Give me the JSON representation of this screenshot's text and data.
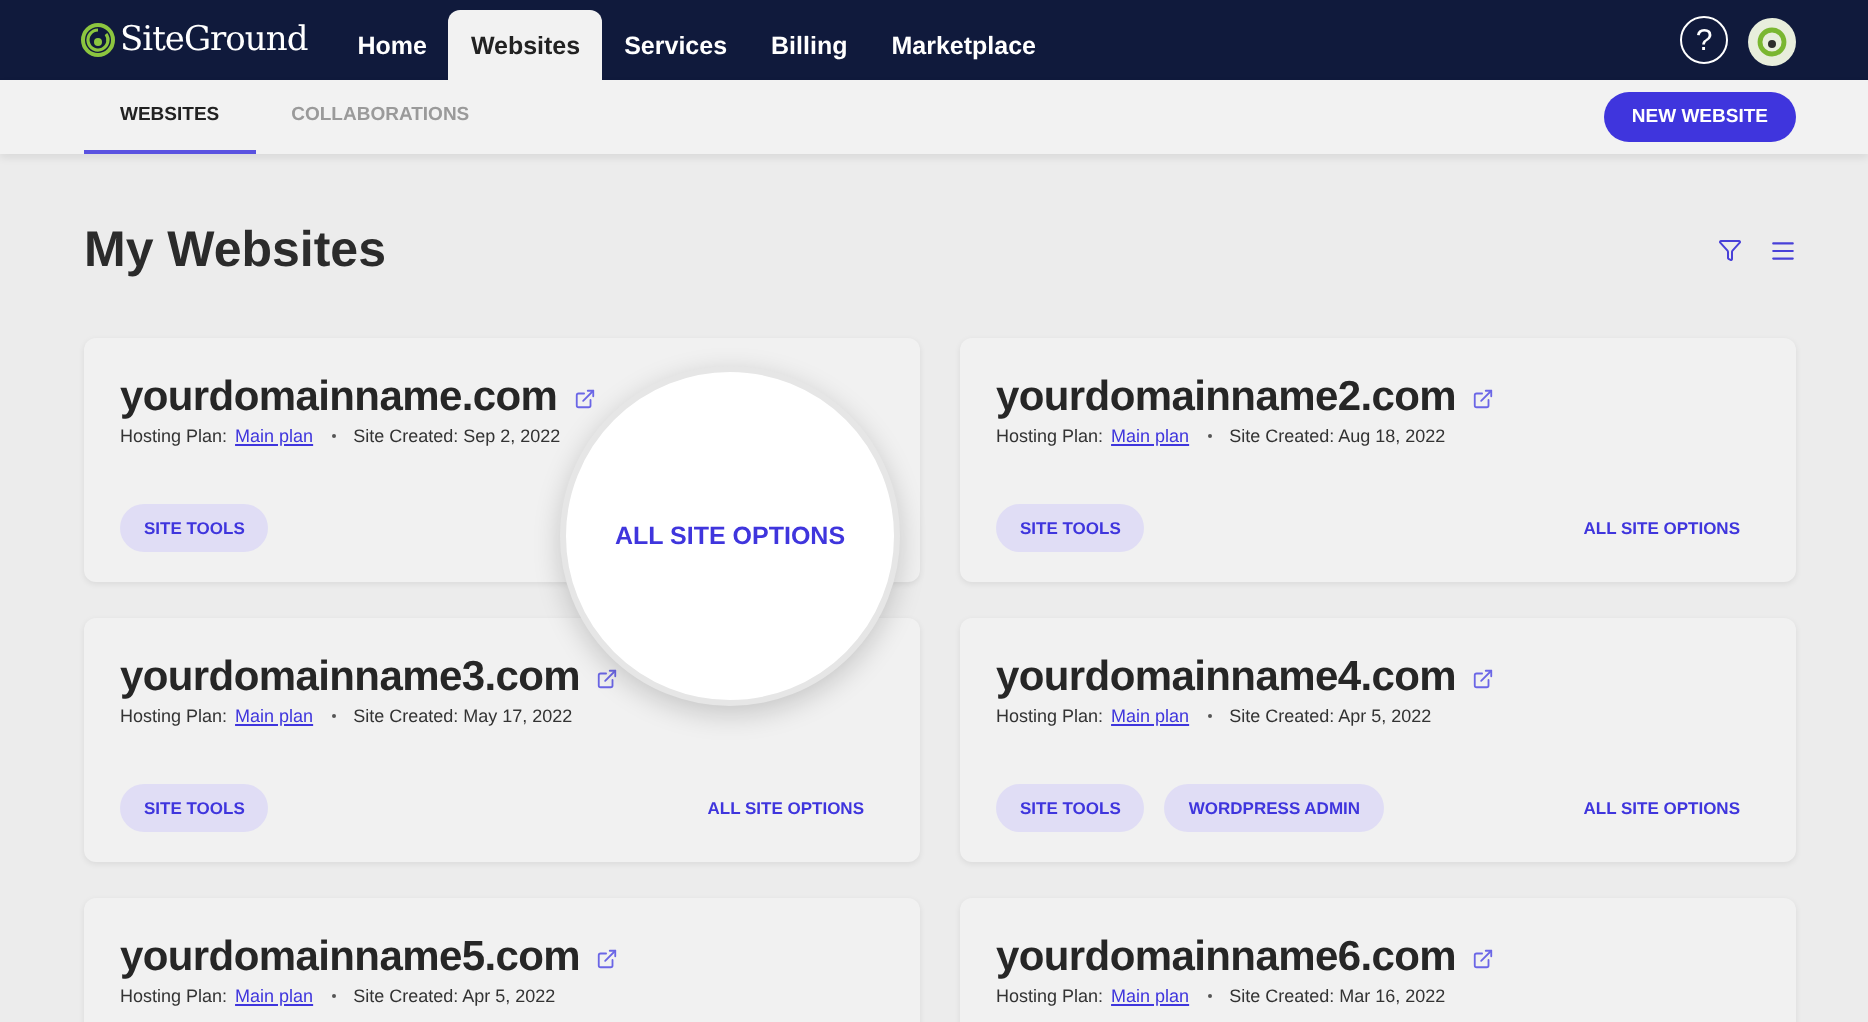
{
  "topbar": {
    "logo": "SiteGround",
    "nav": [
      {
        "label": "Home",
        "selected": false
      },
      {
        "label": "Websites",
        "selected": true
      },
      {
        "label": "Services",
        "selected": false
      },
      {
        "label": "Billing",
        "selected": false
      },
      {
        "label": "Marketplace",
        "selected": false
      }
    ],
    "help": "?"
  },
  "subnav": {
    "tabs": [
      {
        "label": "WEBSITES",
        "selected": true
      },
      {
        "label": "COLLABORATIONS",
        "selected": false
      }
    ],
    "action": "NEW WEBSITE"
  },
  "heading": "My Websites",
  "sites": [
    {
      "name": "yourdomainname.com",
      "plan_label": "Hosting Plan:",
      "plan": "Main plan",
      "created": "Site Created: Sep 2, 2022",
      "buttons": [
        "SITE TOOLS"
      ],
      "options": "ALL SITE OPTIONS",
      "magnified": true
    },
    {
      "name": "yourdomainname2.com",
      "plan_label": "Hosting Plan:",
      "plan": "Main plan",
      "created": "Site Created: Aug 18, 2022",
      "buttons": [
        "SITE TOOLS"
      ],
      "options": "ALL SITE OPTIONS",
      "magnified": false
    },
    {
      "name": "yourdomainname3.com",
      "plan_label": "Hosting Plan:",
      "plan": "Main plan",
      "created": "Site Created: May 17, 2022",
      "buttons": [
        "SITE TOOLS"
      ],
      "options": "ALL SITE OPTIONS",
      "magnified": false
    },
    {
      "name": "yourdomainname4.com",
      "plan_label": "Hosting Plan:",
      "plan": "Main plan",
      "created": "Site Created: Apr 5, 2022",
      "buttons": [
        "SITE TOOLS",
        "WORDPRESS ADMIN"
      ],
      "options": "ALL SITE OPTIONS",
      "magnified": false
    },
    {
      "name": "yourdomainname5.com",
      "plan_label": "Hosting Plan:",
      "plan": "Main plan",
      "created": "Site Created: Apr 5, 2022"
    },
    {
      "name": "yourdomainname6.com",
      "plan_label": "Hosting Plan:",
      "plan": "Main plan",
      "created": "Site Created: Mar 16, 2022"
    }
  ]
}
